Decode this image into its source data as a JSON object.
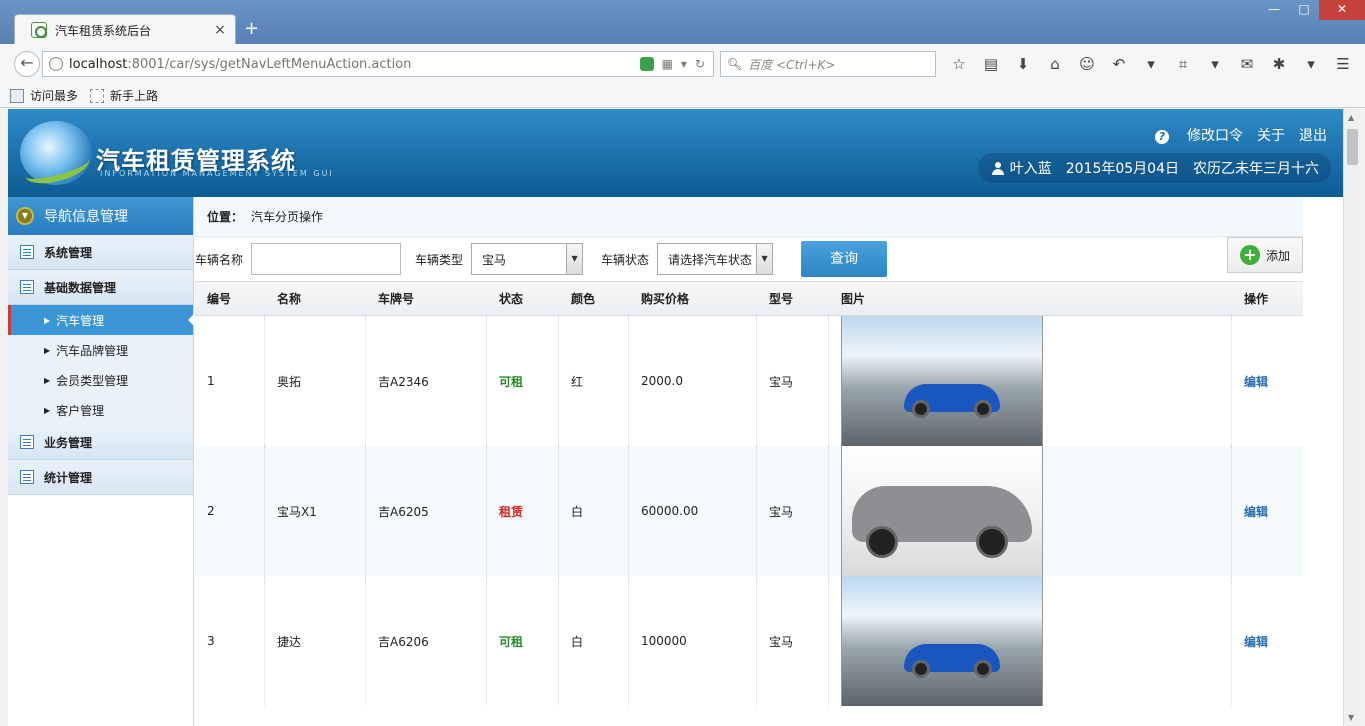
{
  "browser": {
    "tab_title": "汽车租赁系统后台",
    "tab_close": "×",
    "new_tab": "+",
    "url_host": "localhost",
    "url_rest": ":8001/car/sys/getNavLeftMenuAction.action",
    "search_placeholder": "百度 <Ctrl+K>",
    "bookmarks": [
      "访问最多",
      "新手上路"
    ],
    "window_buttons": [
      "—",
      "□",
      "✕"
    ]
  },
  "header": {
    "brand": "汽车租赁管理系统",
    "brand_sub": "INFORMATION MANAGEMENT SYSTEM GUI",
    "links": {
      "change_password": "修改口令",
      "about": "关于",
      "logout": "退出"
    },
    "user": "叶入蓝",
    "date": "2015年05月04日",
    "lunar": "农历乙未年三月十六"
  },
  "sidebar": {
    "title": "导航信息管理",
    "groups": [
      {
        "label": "系统管理"
      },
      {
        "label": "基础数据管理",
        "items": [
          "汽车管理",
          "汽车品牌管理",
          "会员类型管理",
          "客户管理"
        ]
      },
      {
        "label": "业务管理"
      },
      {
        "label": "统计管理"
      }
    ]
  },
  "main": {
    "crumb_label": "位置：",
    "crumb_value": "汽车分页操作",
    "filters": {
      "name_label": "车辆名称",
      "name_value": "",
      "type_label": "车辆类型",
      "type_value": "宝马",
      "status_label": "车辆状态",
      "status_value": "请选择汽车状态",
      "query_button": "查询",
      "add_button": "添加"
    },
    "columns": [
      "编号",
      "名称",
      "车牌号",
      "状态",
      "颜色",
      "购买价格",
      "型号",
      "图片",
      "操作"
    ],
    "rows": [
      {
        "id": "1",
        "name": "奥拓",
        "plate": "吉A2346",
        "status": "可租",
        "color": "红",
        "price": "2000.0",
        "model": "宝马",
        "action": "编辑"
      },
      {
        "id": "2",
        "name": "宝马X1",
        "plate": "吉A6205",
        "status": "租赁",
        "color": "白",
        "price": "60000.00",
        "model": "宝马",
        "action": "编辑"
      },
      {
        "id": "3",
        "name": "捷达",
        "plate": "吉A6206",
        "status": "可租",
        "color": "白",
        "price": "100000",
        "model": "宝马",
        "action": "编辑"
      }
    ]
  },
  "colors": {
    "accent": "#2c84c4",
    "status_available": "#2a8a2a",
    "status_rented": "#e0201a"
  }
}
